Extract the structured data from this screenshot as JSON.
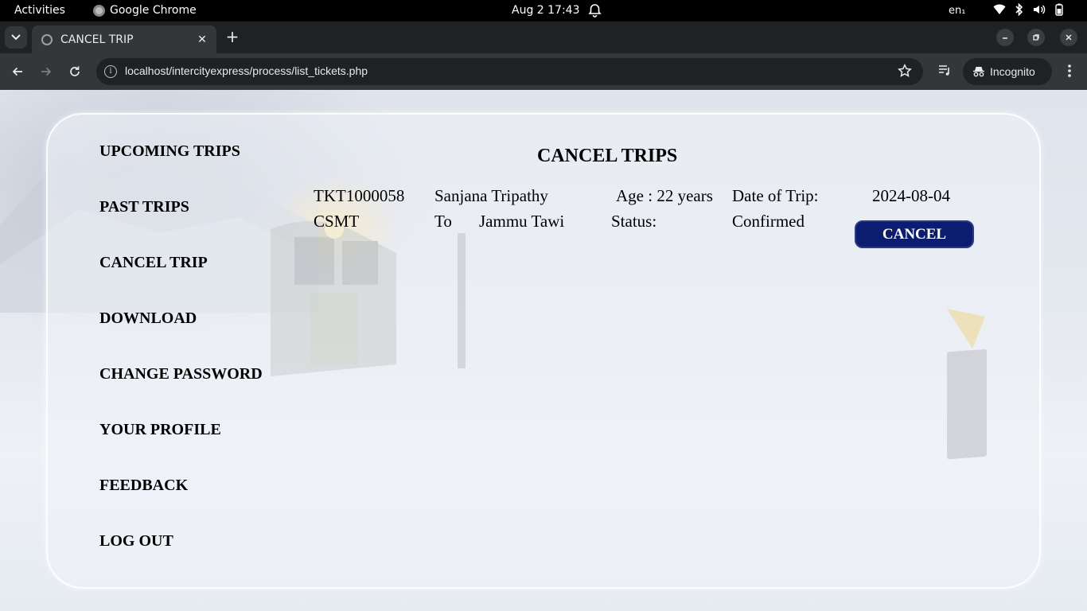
{
  "system_bar": {
    "activities": "Activities",
    "app_name": "Google Chrome",
    "datetime": "Aug 2  17:43",
    "language": "en₁"
  },
  "browser": {
    "tab_title": "CANCEL TRIP",
    "url": "localhost/intercityexpress/process/list_tickets.php",
    "incognito_label": "Incognito"
  },
  "sidebar": {
    "items": [
      {
        "label": "UPCOMING TRIPS"
      },
      {
        "label": "PAST TRIPS"
      },
      {
        "label": "CANCEL TRIP"
      },
      {
        "label": "DOWNLOAD"
      },
      {
        "label": "CHANGE PASSWORD"
      },
      {
        "label": "YOUR PROFILE"
      },
      {
        "label": "FEEDBACK"
      },
      {
        "label": "LOG OUT"
      }
    ]
  },
  "main": {
    "heading": "CANCEL TRIPS",
    "ticket": {
      "ticket_id": "TKT1000058",
      "passenger_name": "Sanjana Tripathy",
      "age": "Age : 22 years",
      "date_label": "Date of Trip:",
      "date_value": "2024-08-04",
      "from": "CSMT",
      "to_label": "To",
      "to": "Jammu Tawi",
      "status_label": "Status:",
      "status_value": "Confirmed",
      "cancel_label": "CANCEL"
    }
  },
  "colors": {
    "cancel_button": "#0c1d6f",
    "chrome_toolbar": "#35363a",
    "chrome_tabstrip": "#202124"
  }
}
